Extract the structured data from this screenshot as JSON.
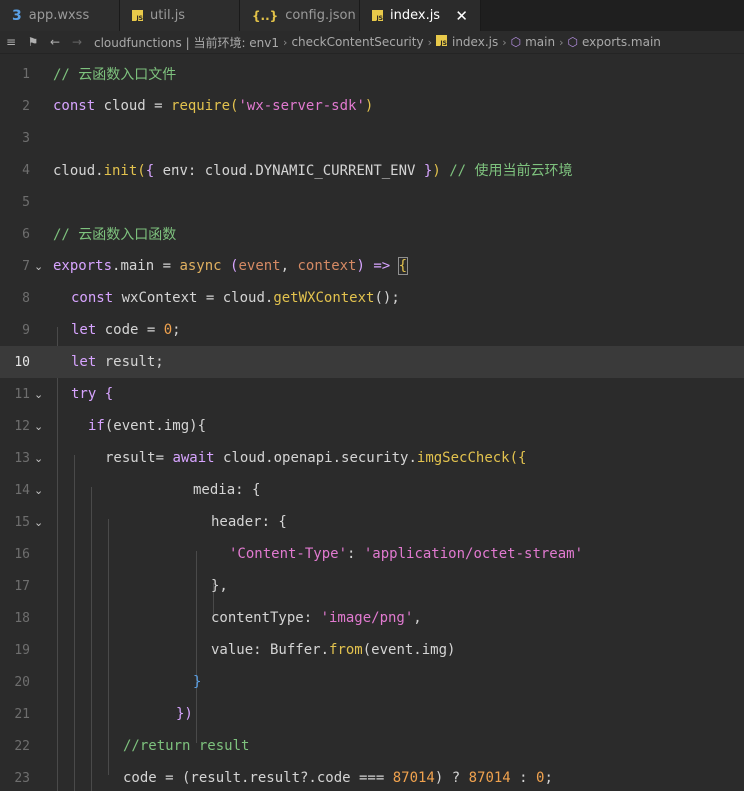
{
  "tabs": [
    {
      "label": "app.wxss",
      "icon": "css-file-icon",
      "active": false
    },
    {
      "label": "util.js",
      "icon": "js-file-icon",
      "active": false
    },
    {
      "label": "config.json",
      "icon": "json-file-icon",
      "active": false
    },
    {
      "label": "index.js",
      "icon": "js-file-icon",
      "active": true
    }
  ],
  "breadcrumb": {
    "path": "cloudfunctions | 当前环境: env1",
    "folder": "checkContentSecurity",
    "file": "index.js",
    "symbol1": "main",
    "symbol2": "exports.main"
  },
  "editor": {
    "current_line": 10,
    "line_numbers": [
      "1",
      "2",
      "3",
      "4",
      "5",
      "6",
      "7",
      "8",
      "9",
      "10",
      "11",
      "12",
      "13",
      "14",
      "15",
      "16",
      "17",
      "18",
      "19",
      "20",
      "21",
      "22",
      "23"
    ],
    "lines": {
      "l1": "// 云函数入口文件",
      "l2a": "const",
      "l2b": " cloud = ",
      "l2c": "require",
      "l2d": "(",
      "l2e": "'wx-server-sdk'",
      "l2f": ")",
      "l4a": "cloud.",
      "l4b": "init",
      "l4c": "(",
      "l4d": "{",
      "l4e": " env: cloud.DYNAMIC_CURRENT_ENV ",
      "l4f": "}",
      "l4g": ")",
      "l4h": " // 使用当前云环境",
      "l6": "// 云函数入口函数",
      "l7a": "exports",
      "l7b": ".main = ",
      "l7c": "async",
      "l7d": " (",
      "l7e": "event",
      "l7f": ", ",
      "l7g": "context",
      "l7h": ") => ",
      "l7i": "{",
      "l8a": "const",
      "l8b": " wxContext = cloud.",
      "l8c": "getWXContext",
      "l8d": "();",
      "l9a": "let",
      "l9b": " code = ",
      "l9c": "0",
      "l9d": ";",
      "l10a": "let",
      "l10b": " result;",
      "l11a": "try",
      "l11b": " {",
      "l12a": "if",
      "l12b": "(event.img){",
      "l13a": "result= ",
      "l13b": "await",
      "l13c": " cloud.openapi.security.",
      "l13d": "imgSecCheck",
      "l13e": "({",
      "l14": "media: {",
      "l15": "header: {",
      "l16a": "'Content-Type'",
      "l16b": ": ",
      "l16c": "'application/octet-stream'",
      "l17": "},",
      "l18a": "contentType: ",
      "l18b": "'image/png'",
      "l18c": ",",
      "l19a": "value: Buffer.",
      "l19b": "from",
      "l19c": "(event.img)",
      "l20": "}",
      "l21": "})",
      "l22": "//return result",
      "l23a": "code = (result.result?.code === ",
      "l23b": "87014",
      "l23c": ") ? ",
      "l23d": "87014",
      "l23e": " : ",
      "l23f": "0",
      "l23g": ";"
    },
    "fold_marker_lines": [
      7,
      11,
      12,
      13,
      14,
      15
    ],
    "colors": {
      "comment": "#7ec27e",
      "keyword": "#d7a4ff",
      "function": "#e2c24e",
      "string": "#e17ad0",
      "number": "#f0a24e",
      "background": "#2b2b2b",
      "current_line": "#3a3a3a"
    }
  }
}
